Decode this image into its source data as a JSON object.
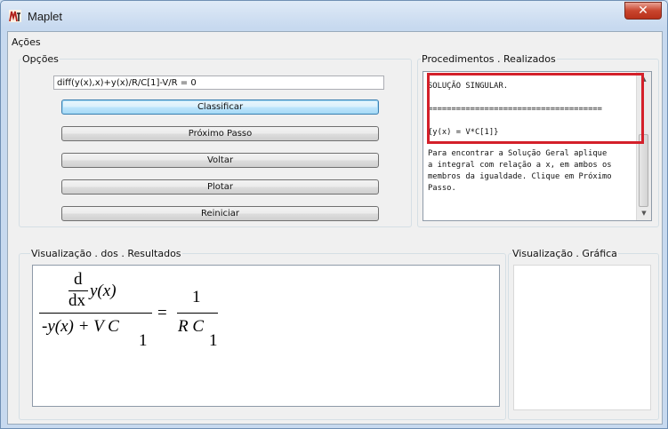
{
  "window": {
    "title": "Maplet",
    "close_label": "✕"
  },
  "menu": {
    "acoes": "Ações"
  },
  "opcoes": {
    "label": "Opções",
    "expression": "diff(y(x),x)+y(x)/R/C[1]-V/R = 0",
    "buttons": [
      "Classificar",
      "Próximo Passo",
      "Voltar",
      "Plotar",
      "Reiniciar"
    ]
  },
  "procedimentos": {
    "label": "Procedimentos . Realizados",
    "lines": [
      "SOLUÇÃO SINGULAR.",
      "=====================================",
      "{y(x) = V*C[1]}",
      "Para encontrar a Solução Geral aplique",
      "a integral com relação a x, em ambos os",
      "membros da igualdade. Clique em Próximo",
      "Passo."
    ]
  },
  "resultados": {
    "label": "Visualização . dos . Resultados",
    "equation": {
      "d": "d",
      "dx": "dx",
      "yx": "y(x)",
      "denominator": "-y(x) + V C",
      "sub": "1",
      "equals": "=",
      "rhs_num": "1",
      "rhs_den": "R C",
      "rhs_sub": "1"
    }
  },
  "grafica": {
    "label": "Visualização . Gráfica"
  }
}
